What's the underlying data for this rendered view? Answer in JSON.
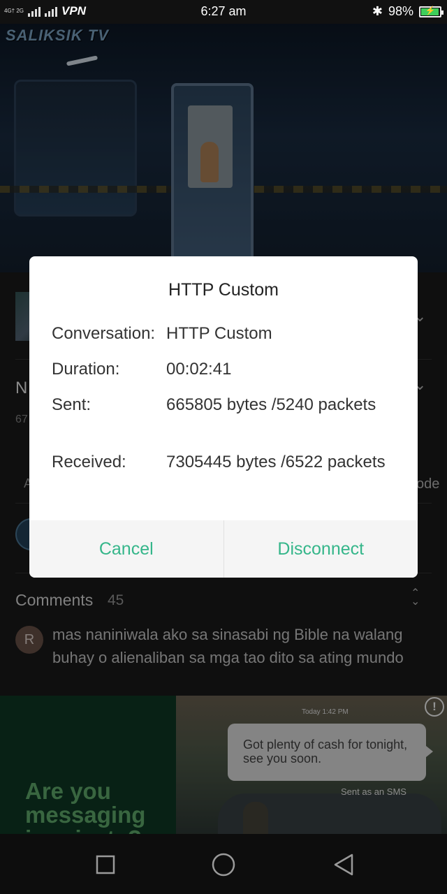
{
  "status_bar": {
    "network_small": "4G† 2G",
    "vpn": "VPN",
    "time": "6:27 am",
    "battery": "98%",
    "battery_level": 0.98
  },
  "video": {
    "channel_logo": "SALIKSIK TV"
  },
  "behind": {
    "title_partial": "N",
    "sub_partial": "67",
    "tab_partial_left": "A",
    "tab_partial_right": "ode"
  },
  "comments": {
    "title": "Comments",
    "count": "45",
    "items": [
      {
        "avatar_letter": "R",
        "text": "mas naniniwala ako sa sinasabi ng Bible na walang buhay o alienaliban sa mga tao dito sa ating mundo"
      }
    ]
  },
  "ad": {
    "headline": "Are you messaging in private?",
    "time": "Today 1:42 PM",
    "bubble": "Got plenty of cash for tonight, see you soon.",
    "sent": "Sent as an SMS",
    "info": "!"
  },
  "dialog": {
    "title": "HTTP Custom",
    "rows": [
      {
        "label": "Conversation:",
        "value": "HTTP Custom"
      },
      {
        "label": "Duration:",
        "value": "00:02:41"
      },
      {
        "label": "Sent:",
        "value": "665805 bytes /5240 packets"
      },
      {
        "label": "Received:",
        "value": "7305445 bytes /6522 packets"
      }
    ],
    "cancel": "Cancel",
    "disconnect": "Disconnect",
    "accent": "#35b68a"
  }
}
